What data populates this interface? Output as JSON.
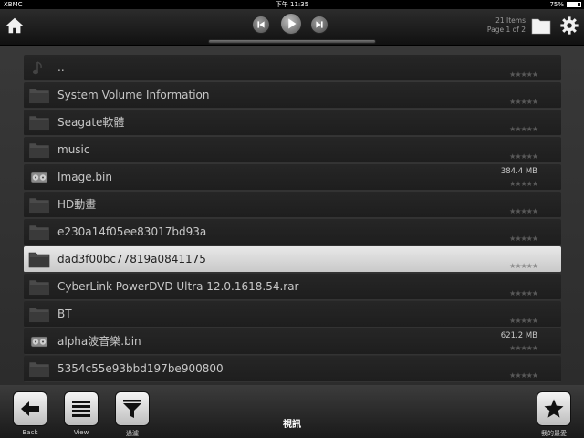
{
  "status_bar": {
    "carrier": "XBMC",
    "time": "下午 11:35",
    "battery_text": "75%",
    "battery_level": 0.75
  },
  "top_bar": {
    "items_count": "21 Items",
    "page_info": "Page 1 of 2",
    "icons": {
      "home": "home-icon",
      "prev": "previous-track-icon",
      "play": "play-icon",
      "next": "next-track-icon",
      "folder": "folder-icon",
      "settings": "gear-icon"
    }
  },
  "files": [
    {
      "name": "..",
      "icon": "music-note-icon",
      "size": "",
      "selected": false
    },
    {
      "name": "System Volume Information",
      "icon": "folder-icon",
      "size": "",
      "selected": false
    },
    {
      "name": "Seagate軟體",
      "icon": "folder-icon",
      "size": "",
      "selected": false
    },
    {
      "name": "music",
      "icon": "folder-icon",
      "size": "",
      "selected": false
    },
    {
      "name": "Image.bin",
      "icon": "film-reel-icon",
      "size": "384.4 MB",
      "selected": false
    },
    {
      "name": "HD動畫",
      "icon": "folder-icon",
      "size": "",
      "selected": false
    },
    {
      "name": "e230a14f05ee83017bd93a",
      "icon": "folder-icon",
      "size": "",
      "selected": false
    },
    {
      "name": "dad3f00bc77819a0841175",
      "icon": "folder-icon",
      "size": "",
      "selected": true
    },
    {
      "name": "CyberLink PowerDVD Ultra 12.0.1618.54.rar",
      "icon": "folder-icon",
      "size": "",
      "selected": false
    },
    {
      "name": "BT",
      "icon": "folder-icon",
      "size": "",
      "selected": false
    },
    {
      "name": "alpha波音樂.bin",
      "icon": "film-reel-icon",
      "size": "621.2 MB",
      "selected": false
    },
    {
      "name": "5354c55e93bbd197be900800",
      "icon": "folder-icon",
      "size": "",
      "selected": false
    }
  ],
  "rating_glyphs": "★★★★★",
  "bottom_bar": {
    "back_label": "Back",
    "view_label": "View",
    "filter_label": "過濾",
    "center_title": "視訊",
    "favorites_label": "我的最愛"
  },
  "colors": {
    "selected_row": "#dcdcdc",
    "row_bg": "#222222",
    "text": "#c8c8c8"
  }
}
